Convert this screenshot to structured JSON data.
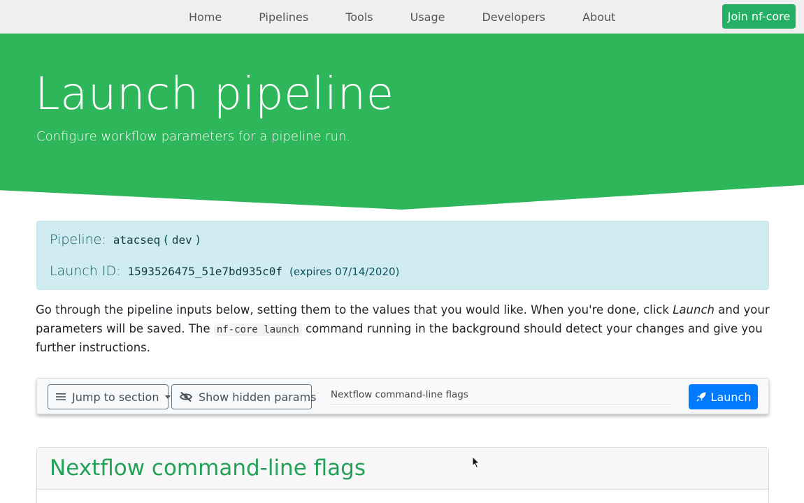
{
  "navbar": {
    "links": [
      "Home",
      "Pipelines",
      "Tools",
      "Usage",
      "Developers",
      "About"
    ],
    "join_label": "Join nf-core"
  },
  "hero": {
    "title": "Launch pipeline",
    "subtitle": "Configure workflow parameters for a pipeline run."
  },
  "info": {
    "pipeline_label": "Pipeline:",
    "pipeline_name": "atacseq",
    "pipeline_version": "dev",
    "launch_label": "Launch ID:",
    "launch_id": "1593526475_51e7bd935c0f",
    "expires": "(expires 07/14/2020)"
  },
  "intro": {
    "part1": "Go through the pipeline inputs below, setting them to the values that you would like. When you're done, click ",
    "emphasis": "Launch",
    "part2": " and your parameters will be saved. The ",
    "code": "nf-core launch",
    "part3": " command running in the background should detect your changes and give you further instructions."
  },
  "toolbar": {
    "jump_label": "Jump to section",
    "hidden_label": "Show hidden params",
    "current_section": "Nextflow command-line flags",
    "launch_label": "Launch"
  },
  "section": {
    "title": "Nextflow command-line flags"
  },
  "icons": {
    "jump": "list-icon",
    "hidden": "eye-slash-icon",
    "launch": "rocket-icon"
  },
  "colors": {
    "brand_green": "#2EB65B",
    "join_green": "#24B064",
    "info_bg": "#d1ecf1",
    "primary_blue": "#007bff",
    "section_green": "#24A158"
  }
}
